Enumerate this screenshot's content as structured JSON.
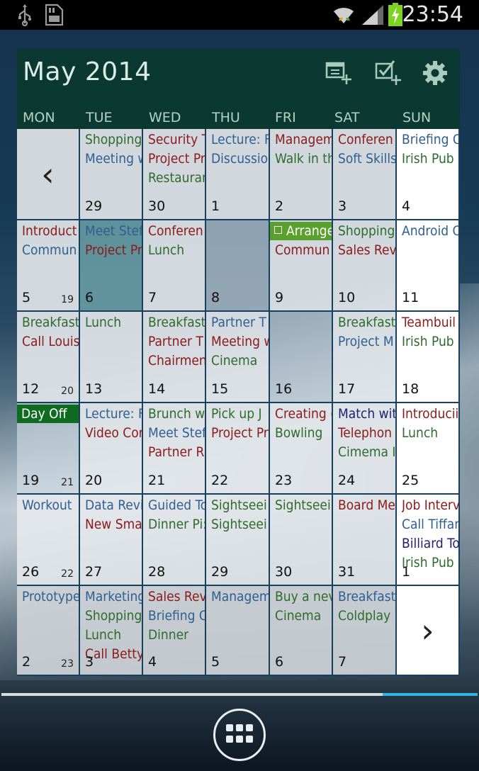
{
  "status_bar": {
    "time": "23:54",
    "icons": [
      "usb-icon",
      "sd-card-icon",
      "wifi-icon",
      "signal-icon",
      "battery-charging-icon"
    ]
  },
  "header": {
    "month_title": "May 2014",
    "buttons": [
      "add-event-icon",
      "add-task-icon",
      "settings-gear-icon"
    ],
    "weekdays": [
      "MON",
      "TUE",
      "WED",
      "THU",
      "FRI",
      "SAT",
      "SUN"
    ]
  },
  "colors": {
    "blue": "#2f5f8f",
    "green": "#2e6b2c",
    "red": "#8b1a1a",
    "navy": "#1f1f6e",
    "chip_green": "#5aa02c",
    "chip_dark_green": "#0f6b1f"
  },
  "nav": {
    "prev": "‹",
    "next": "›"
  },
  "weeks": [
    {
      "week_label": "",
      "days": [
        {
          "type": "prev-nav"
        },
        {
          "num": "29",
          "bg": "light",
          "events": [
            {
              "t": "Shopping",
              "c": "green"
            },
            {
              "t": "Meeting w",
              "c": "blue"
            }
          ]
        },
        {
          "num": "30",
          "bg": "light",
          "events": [
            {
              "t": "Security T",
              "c": "red"
            },
            {
              "t": "Project Pr",
              "c": "red"
            },
            {
              "t": "Restaurar",
              "c": "green"
            }
          ]
        },
        {
          "num": "1",
          "bg": "light",
          "events": [
            {
              "t": "Lecture: F",
              "c": "blue"
            },
            {
              "t": "Discussio",
              "c": "blue"
            }
          ]
        },
        {
          "num": "2",
          "bg": "light",
          "events": [
            {
              "t": "Managem",
              "c": "red"
            },
            {
              "t": "Walk in th",
              "c": "green"
            }
          ]
        },
        {
          "num": "3",
          "bg": "light",
          "events": [
            {
              "t": "Conferen",
              "c": "red"
            },
            {
              "t": "Soft Skills",
              "c": "blue"
            }
          ]
        },
        {
          "num": "4",
          "bg": "white",
          "events": [
            {
              "t": "Briefing C",
              "c": "blue"
            },
            {
              "t": "Irish Pub",
              "c": "green"
            }
          ]
        }
      ]
    },
    {
      "week_label": "19",
      "days": [
        {
          "num": "5",
          "bg": "light",
          "events": [
            {
              "t": "Introduct",
              "c": "red"
            },
            {
              "t": "Commun",
              "c": "blue"
            }
          ]
        },
        {
          "num": "6",
          "bg": "teal",
          "events": [
            {
              "t": "Meet Stef",
              "c": "blue"
            },
            {
              "t": "Project Pr",
              "c": "red"
            }
          ]
        },
        {
          "num": "7",
          "bg": "light",
          "events": [
            {
              "t": "Conferen",
              "c": "red"
            },
            {
              "t": "Lunch",
              "c": "green"
            }
          ]
        },
        {
          "num": "8",
          "bg": "glass",
          "events": []
        },
        {
          "num": "9",
          "bg": "light",
          "events": [
            {
              "t": "Arrange",
              "c": "chip_green",
              "chip": true,
              "check": true
            },
            {
              "t": "Commun",
              "c": "red"
            }
          ]
        },
        {
          "num": "10",
          "bg": "light",
          "events": [
            {
              "t": "Shopping",
              "c": "green"
            },
            {
              "t": "Sales Rev",
              "c": "red"
            }
          ]
        },
        {
          "num": "11",
          "bg": "white",
          "events": [
            {
              "t": "Android C",
              "c": "blue"
            }
          ]
        }
      ]
    },
    {
      "week_label": "20",
      "days": [
        {
          "num": "12",
          "bg": "light",
          "events": [
            {
              "t": "Breakfast",
              "c": "green"
            },
            {
              "t": "Call Louis",
              "c": "red"
            }
          ]
        },
        {
          "num": "13",
          "bg": "light",
          "events": [
            {
              "t": "Lunch",
              "c": "green"
            }
          ]
        },
        {
          "num": "14",
          "bg": "light",
          "events": [
            {
              "t": "Breakfast",
              "c": "green"
            },
            {
              "t": "Partner T",
              "c": "red"
            },
            {
              "t": "Chairmen",
              "c": "red"
            }
          ]
        },
        {
          "num": "15",
          "bg": "light",
          "events": [
            {
              "t": "Partner T",
              "c": "blue"
            },
            {
              "t": "Meeting w",
              "c": "red"
            },
            {
              "t": "Cinema",
              "c": "green"
            }
          ]
        },
        {
          "num": "16",
          "bg": "glass",
          "events": []
        },
        {
          "num": "17",
          "bg": "light",
          "events": [
            {
              "t": "Breakfast",
              "c": "green"
            },
            {
              "t": "Project M",
              "c": "blue"
            }
          ]
        },
        {
          "num": "18",
          "bg": "white",
          "events": [
            {
              "t": "Teambuil",
              "c": "red"
            },
            {
              "t": "Irish Pub",
              "c": "green"
            }
          ]
        }
      ]
    },
    {
      "week_label": "21",
      "days": [
        {
          "num": "19",
          "bg": "glass",
          "events": [
            {
              "t": "Day Off",
              "c": "chip_dark_green",
              "chip": true
            }
          ]
        },
        {
          "num": "20",
          "bg": "light",
          "events": [
            {
              "t": "Lecture: F",
              "c": "blue"
            },
            {
              "t": "Video Cor",
              "c": "red"
            }
          ]
        },
        {
          "num": "21",
          "bg": "light",
          "events": [
            {
              "t": "Brunch w",
              "c": "green"
            },
            {
              "t": "Meet Stef",
              "c": "blue"
            },
            {
              "t": "Partner R",
              "c": "red"
            }
          ]
        },
        {
          "num": "22",
          "bg": "light",
          "events": [
            {
              "t": "Pick up J",
              "c": "green"
            },
            {
              "t": "Project Pr",
              "c": "red"
            }
          ]
        },
        {
          "num": "23",
          "bg": "light",
          "events": [
            {
              "t": "Creating (",
              "c": "red"
            },
            {
              "t": "Bowling",
              "c": "green"
            }
          ]
        },
        {
          "num": "24",
          "bg": "light",
          "events": [
            {
              "t": "Match wit",
              "c": "navy"
            },
            {
              "t": "Telephon",
              "c": "red"
            },
            {
              "t": "Cimema I",
              "c": "green"
            }
          ]
        },
        {
          "num": "25",
          "bg": "white",
          "events": [
            {
              "t": "Introducii",
              "c": "red"
            },
            {
              "t": "Lunch",
              "c": "green"
            }
          ]
        }
      ]
    },
    {
      "week_label": "22",
      "days": [
        {
          "num": "26",
          "bg": "light",
          "events": [
            {
              "t": "Workout",
              "c": "blue"
            }
          ]
        },
        {
          "num": "27",
          "bg": "light",
          "events": [
            {
              "t": "Data Revi",
              "c": "blue"
            },
            {
              "t": "New Sma",
              "c": "red"
            }
          ]
        },
        {
          "num": "28",
          "bg": "light",
          "events": [
            {
              "t": "Guided To",
              "c": "blue"
            },
            {
              "t": "Dinner Pi:",
              "c": "green"
            }
          ]
        },
        {
          "num": "29",
          "bg": "light",
          "events": [
            {
              "t": "Sightseei",
              "c": "green"
            },
            {
              "t": "Sightseei",
              "c": "green"
            }
          ]
        },
        {
          "num": "30",
          "bg": "light",
          "events": [
            {
              "t": "Sightseei",
              "c": "green"
            }
          ]
        },
        {
          "num": "31",
          "bg": "light",
          "events": [
            {
              "t": "Board Me",
              "c": "red"
            }
          ]
        },
        {
          "num": "1",
          "bg": "white",
          "events": [
            {
              "t": "Job Interv",
              "c": "red"
            },
            {
              "t": "Call Tiffan",
              "c": "blue"
            },
            {
              "t": "Billiard To",
              "c": "navy"
            },
            {
              "t": "Irish Pub",
              "c": "green"
            }
          ]
        }
      ]
    },
    {
      "week_label": "23",
      "days": [
        {
          "num": "2",
          "bg": "grey",
          "events": [
            {
              "t": "Prototype",
              "c": "blue"
            }
          ]
        },
        {
          "num": "3",
          "bg": "grey",
          "events": [
            {
              "t": "Marketing",
              "c": "blue"
            },
            {
              "t": "Shopping",
              "c": "green"
            },
            {
              "t": "Lunch",
              "c": "green"
            },
            {
              "t": "Call Betty",
              "c": "red"
            }
          ]
        },
        {
          "num": "4",
          "bg": "grey",
          "events": [
            {
              "t": "Sales Rev",
              "c": "red"
            },
            {
              "t": "Briefing C",
              "c": "blue"
            },
            {
              "t": "Dinner",
              "c": "green"
            }
          ]
        },
        {
          "num": "5",
          "bg": "grey",
          "events": [
            {
              "t": "Managem",
              "c": "blue"
            }
          ]
        },
        {
          "num": "6",
          "bg": "grey",
          "events": [
            {
              "t": "Buy a nev",
              "c": "green"
            },
            {
              "t": "Cinema",
              "c": "green"
            }
          ]
        },
        {
          "num": "7",
          "bg": "grey",
          "events": [
            {
              "t": "Breakfast",
              "c": "blue"
            },
            {
              "t": "Coldplay (",
              "c": "green"
            }
          ]
        },
        {
          "type": "next-nav"
        }
      ]
    }
  ],
  "bottom": {
    "page_progress": 0.2,
    "apps_button": "app-drawer-icon"
  }
}
